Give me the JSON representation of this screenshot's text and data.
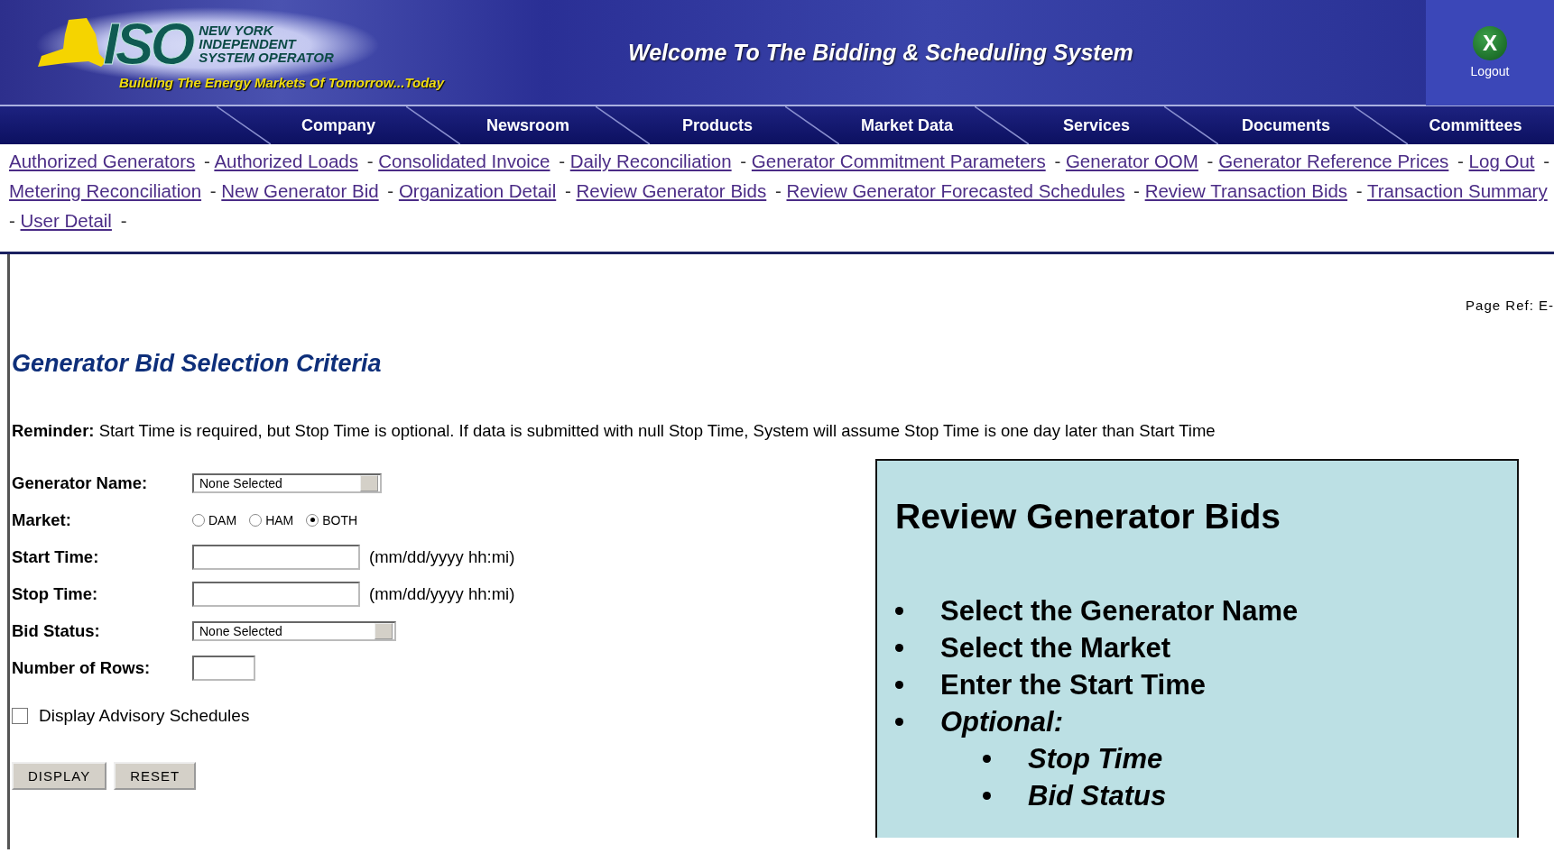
{
  "header": {
    "logo": {
      "letters": "ISO",
      "lines": [
        "NEW YORK",
        "INDEPENDENT",
        "SYSTEM OPERATOR"
      ],
      "tagline": "Building The Energy Markets Of Tomorrow...Today"
    },
    "title": "Welcome To The Bidding & Scheduling System",
    "logout": {
      "icon_label": "X",
      "label": "Logout"
    }
  },
  "nav": [
    "Company",
    "Newsroom",
    "Products",
    "Market Data",
    "Services",
    "Documents",
    "Committees"
  ],
  "links": [
    "Authorized Generators",
    "Authorized Loads",
    "Consolidated Invoice",
    "Daily Reconciliation",
    "Generator Commitment Parameters",
    "Generator OOM",
    "Generator Reference Prices",
    "Log Out",
    "Metering Reconciliation",
    "New Generator Bid",
    "Organization Detail",
    "Review Generator Bids",
    "Review Generator Forecasted Schedules",
    "Review Transaction Bids",
    "Transaction Summary",
    "User Detail"
  ],
  "link_separator": "-",
  "page_ref": "Page Ref: E-",
  "heading": "Generator Bid Selection Criteria",
  "reminder": "**Reminder:** Start Time is required, but Stop Time is optional. If data is submitted with null Stop Time, System will assume Stop Time is one day later than Start Time",
  "form": [
    {
      "kind": "select",
      "label": "Generator Name:",
      "value": "None Selected"
    },
    {
      "kind": "radio",
      "label": "Market:",
      "options": [
        {
          "label": "DAM",
          "selected": false
        },
        {
          "label": "HAM",
          "selected": false
        },
        {
          "label": "BOTH",
          "selected": true
        }
      ]
    },
    {
      "kind": "text",
      "label": "Start Time:",
      "hint": "(mm/dd/yyyy hh:mi)"
    },
    {
      "kind": "text",
      "label": "Stop Time:",
      "hint": "(mm/dd/yyyy hh:mi)"
    },
    {
      "kind": "select",
      "label": "Bid Status:",
      "value": "None Selected"
    },
    {
      "kind": "short",
      "label": "Number of Rows:"
    }
  ],
  "advisory": {
    "label": "Display Advisory Schedules",
    "checked": false
  },
  "buttons": [
    "DISPLAY",
    "RESET"
  ],
  "callout": {
    "title": "Review Generator Bids",
    "steps": [
      {
        "text": "Select the Generator Name"
      },
      {
        "text": "Select the Market"
      },
      {
        "text": "Enter the Start Time"
      },
      {
        "text": "Optional:",
        "italic": true,
        "children": [
          {
            "text": "Stop Time"
          },
          {
            "text": "Bid Status"
          }
        ]
      }
    ]
  }
}
